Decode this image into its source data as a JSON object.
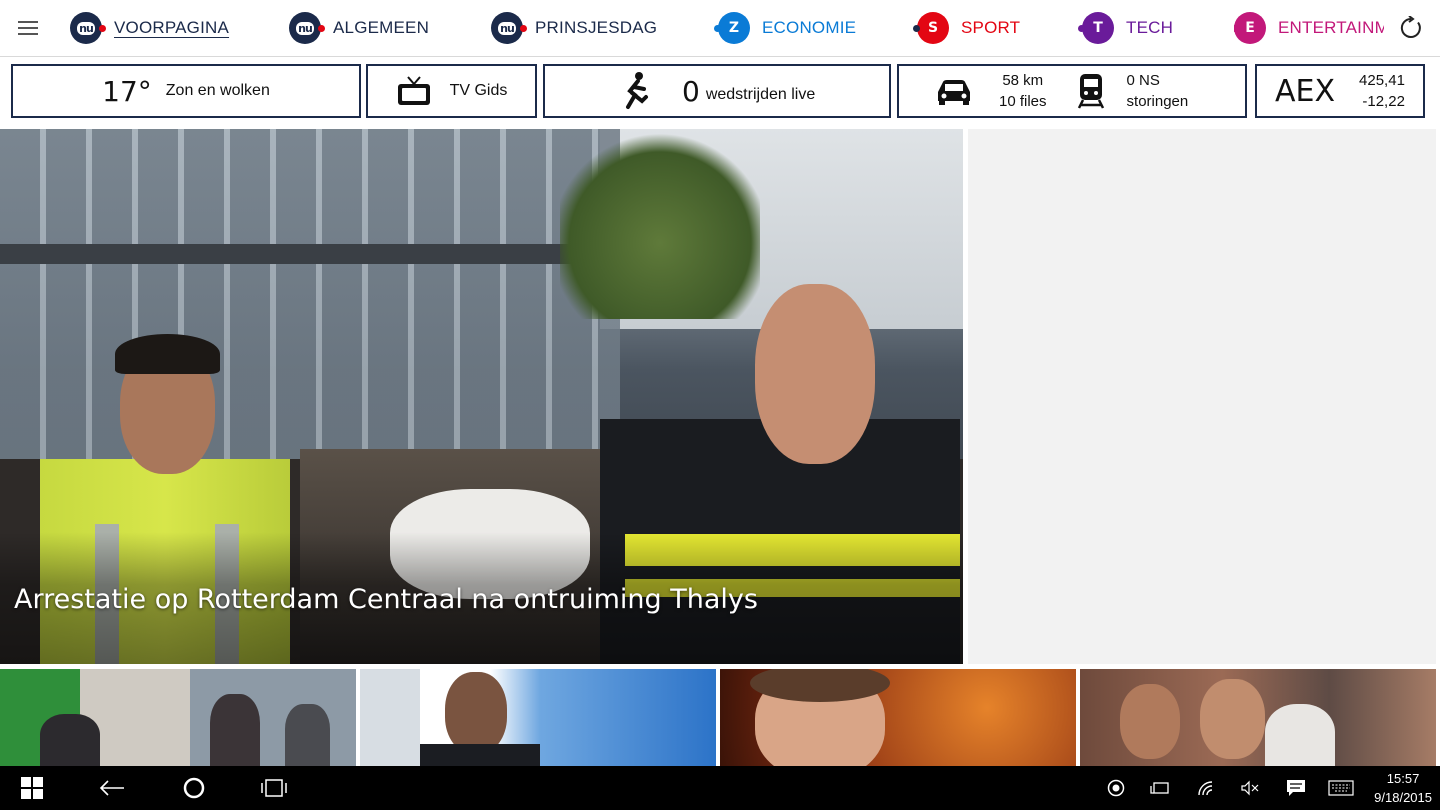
{
  "nav": {
    "items": [
      {
        "label": "VOORPAGINA",
        "color": "#1b2a4a",
        "logo": "nu"
      },
      {
        "label": "ALGEMEEN",
        "color": "#1b2a4a",
        "logo": "nu"
      },
      {
        "label": "PRINSJESDAG",
        "color": "#1b2a4a",
        "logo": "nu"
      },
      {
        "label": "ECONOMIE",
        "color": "#0a7bd6",
        "logo": "Z"
      },
      {
        "label": "SPORT",
        "color": "#e30613",
        "logo": "S"
      },
      {
        "label": "TECH",
        "color": "#6a1b9a",
        "logo": "T"
      },
      {
        "label": "ENTERTAINM",
        "color": "#c2187a",
        "logo": "E"
      }
    ]
  },
  "info": {
    "weather": {
      "temp": "17°",
      "desc": "Zon en wolken"
    },
    "tv": {
      "label": "TV Gids"
    },
    "sport": {
      "count": "0",
      "label": "wedstrijden live"
    },
    "traffic": {
      "km": "58 km",
      "files": "10 files",
      "ns_count": "0 NS",
      "ns_label": "storingen"
    },
    "aex": {
      "label": "AEX",
      "value": "425,41",
      "change": "-12,22"
    }
  },
  "hero": {
    "title": "Arrestatie op Rotterdam Centraal na ontruiming Thalys"
  },
  "taskbar": {
    "time": "15:57",
    "date": "9/18/2015"
  },
  "colors": {
    "navy": "#1b2a4a",
    "ad_bg": "#f2f2f2",
    "taskbar": "#000000"
  }
}
